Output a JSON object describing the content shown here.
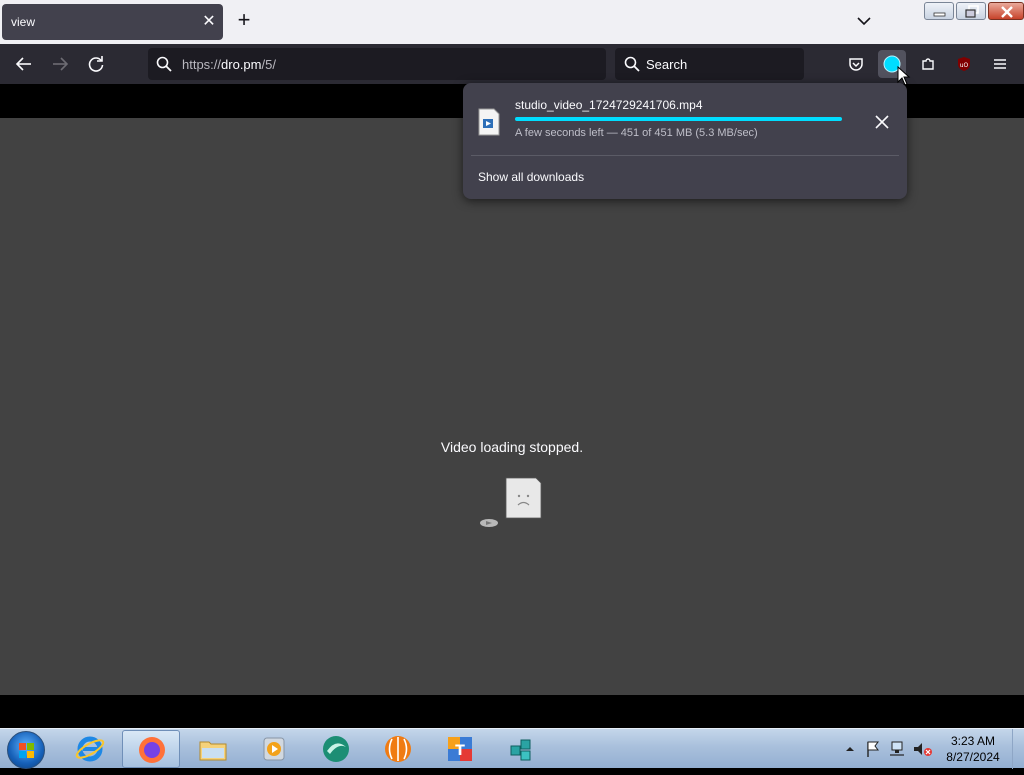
{
  "tab": {
    "title": "view",
    "close_icon": "close-icon"
  },
  "toolbar": {
    "url_prefix": "https://",
    "url_host": "dro.pm",
    "url_path": "/5/",
    "search_placeholder": "Search"
  },
  "download": {
    "filename": "studio_video_1724729241706.mp4",
    "status": "A few seconds left — 451 of 451 MB (5.3 MB/sec)",
    "progress": 1.0,
    "show_all_label": "Show all downloads",
    "accent_color": "#00ddff"
  },
  "content": {
    "message": "Video loading stopped."
  },
  "clock": {
    "time": "3:23 AM",
    "date": "8/27/2024"
  }
}
